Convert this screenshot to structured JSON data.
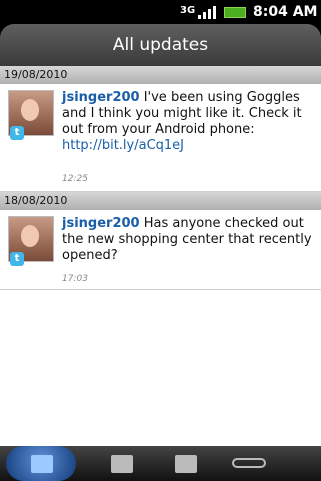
{
  "statusbar": {
    "network": "3G",
    "time": "8:04 AM"
  },
  "title": "All updates",
  "feed": [
    {
      "date": "19/08/2010",
      "user": "jsinger200",
      "message_part1": " I've been using Goggles and I think you might like it. Check it out from your Android phone: ",
      "link": "http://bit.ly/aCq1eJ",
      "time": "12:25"
    },
    {
      "date": "18/08/2010",
      "user": "jsinger200",
      "message_part1": " Has anyone checked out the new shopping center that recently opened?",
      "link": "",
      "time": "17:03"
    }
  ],
  "tabs": [
    {
      "icon": "people-icon"
    },
    {
      "icon": "compose-icon"
    },
    {
      "icon": "photos-icon"
    },
    {
      "icon": "link-icon"
    }
  ]
}
